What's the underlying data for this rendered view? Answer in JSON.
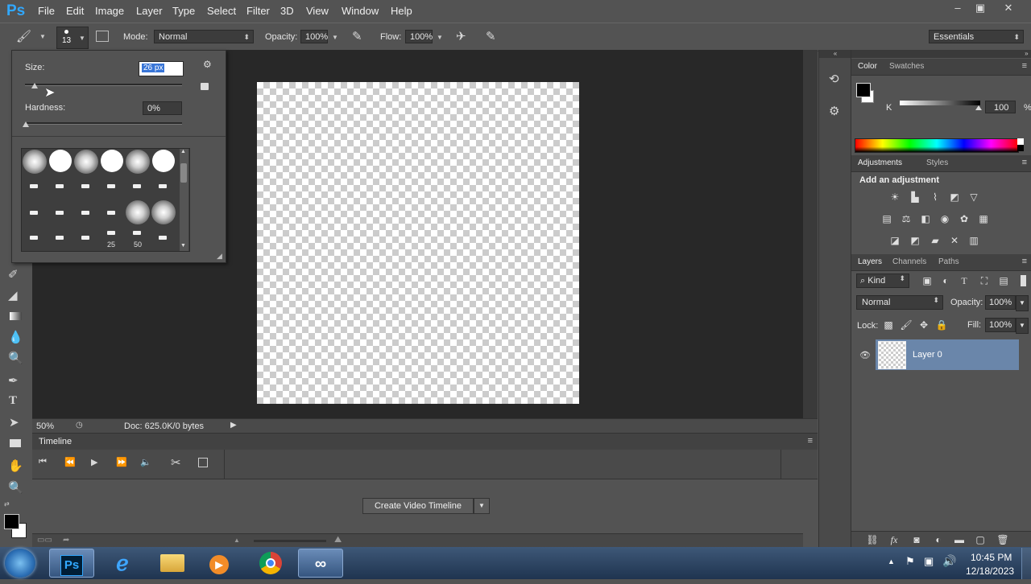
{
  "app": {
    "logo": "Ps"
  },
  "menu": [
    "File",
    "Edit",
    "Image",
    "Layer",
    "Type",
    "Select",
    "Filter",
    "3D",
    "View",
    "Window",
    "Help"
  ],
  "window_controls": {
    "minimize": "–",
    "restore": "▣",
    "close": "✕"
  },
  "options": {
    "brush_size": "13",
    "mode_label": "Mode:",
    "mode_value": "Normal",
    "opacity_label": "Opacity:",
    "opacity_value": "100%",
    "flow_label": "Flow:",
    "flow_value": "100%",
    "workspace": "Essentials"
  },
  "brush_picker": {
    "size_label": "Size:",
    "size_value": "26 px",
    "size_level": 0.06,
    "hardness_label": "Hardness:",
    "hardness_value": "0%",
    "brush_labels": [
      "25",
      "50"
    ]
  },
  "status": {
    "zoom": "50%",
    "doc": "Doc: 625.0K/0 bytes"
  },
  "timeline": {
    "title": "Timeline",
    "create_button": "Create Video Timeline"
  },
  "color_panel": {
    "tabs": [
      "Color",
      "Swatches"
    ],
    "channel": "K",
    "value": "100",
    "unit": "%"
  },
  "adjustments_panel": {
    "tabs": [
      "Adjustments",
      "Styles"
    ],
    "heading": "Add an adjustment"
  },
  "layers_panel": {
    "tabs": [
      "Layers",
      "Channels",
      "Paths"
    ],
    "filter": "Kind",
    "blend_mode": "Normal",
    "opacity_label": "Opacity:",
    "opacity_value": "100%",
    "lock_label": "Lock:",
    "fill_label": "Fill:",
    "fill_value": "100%",
    "layers": [
      {
        "name": "Layer 0",
        "visible": true,
        "selected": true
      }
    ]
  },
  "taskbar": {
    "time": "10:45 PM",
    "date": "12/18/2023"
  },
  "colors": {
    "accent": "#31a8ff",
    "selected_layer": "#6a86aa",
    "selection_highlight": "#3875d7"
  }
}
